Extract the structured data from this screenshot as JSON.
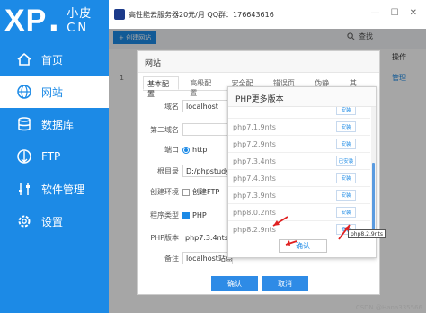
{
  "sidebar": {
    "logo_main": "XP",
    "logo_dot": ".",
    "logo_cn1": "小皮",
    "logo_cn2": "CN",
    "items": [
      {
        "label": "首页",
        "icon": "home-icon"
      },
      {
        "label": "网站",
        "icon": "globe-icon",
        "active": true
      },
      {
        "label": "数据库",
        "icon": "database-icon"
      },
      {
        "label": "FTP",
        "icon": "ftp-icon"
      },
      {
        "label": "软件管理",
        "icon": "sliders-icon"
      },
      {
        "label": "设置",
        "icon": "gear-icon"
      }
    ]
  },
  "topbar": {
    "ad_text": "高性能云服务器20元/月  QQ群：176643616",
    "win_buttons": [
      "—",
      "☐",
      "✕"
    ]
  },
  "toolbar": {
    "create_label": "+ 创建网站",
    "search_label": "查找"
  },
  "bg_table": {
    "op_header": "操作",
    "row_num": "1",
    "manage_label": "管理"
  },
  "site_dialog": {
    "title": "网站",
    "tabs": [
      "基本配置",
      "高级配置",
      "安全配置",
      "错误页面",
      "伪静态",
      "其他"
    ],
    "fields": {
      "domain_label": "域名",
      "domain_value": "localhost",
      "second_domain_label": "第二域名",
      "port_label": "端口",
      "port_option": "http",
      "root_label": "根目录",
      "root_value": "D:/phpstudy_p",
      "env_label": "创建环境",
      "env_option": "创建FTP",
      "type_label": "程序类型",
      "type_option": "PHP",
      "php_label": "PHP版本",
      "php_value": "php7.3.4nts",
      "note_label": "备注",
      "note_value": "localhost站点"
    },
    "ok_label": "确认",
    "cancel_label": "取消"
  },
  "php_popup": {
    "title": "PHP更多版本",
    "versions": [
      {
        "name": "",
        "action": "安装"
      },
      {
        "name": "php7.1.9nts",
        "action": "安装"
      },
      {
        "name": "php7.2.9nts",
        "action": "安装"
      },
      {
        "name": "php7.3.4nts",
        "action": "已安装"
      },
      {
        "name": "php7.4.3nts",
        "action": "安装"
      },
      {
        "name": "php7.3.9nts",
        "action": "安装"
      },
      {
        "name": "php8.0.2nts",
        "action": "安装"
      },
      {
        "name": "php8.2.9nts",
        "action": "安装"
      }
    ],
    "ok_label": "确认"
  },
  "tooltip": "php8.2.9nts",
  "watermark": "CSDN @Hana335566",
  "colors": {
    "accent": "#1c8ae6",
    "arrow": "#e02020"
  }
}
